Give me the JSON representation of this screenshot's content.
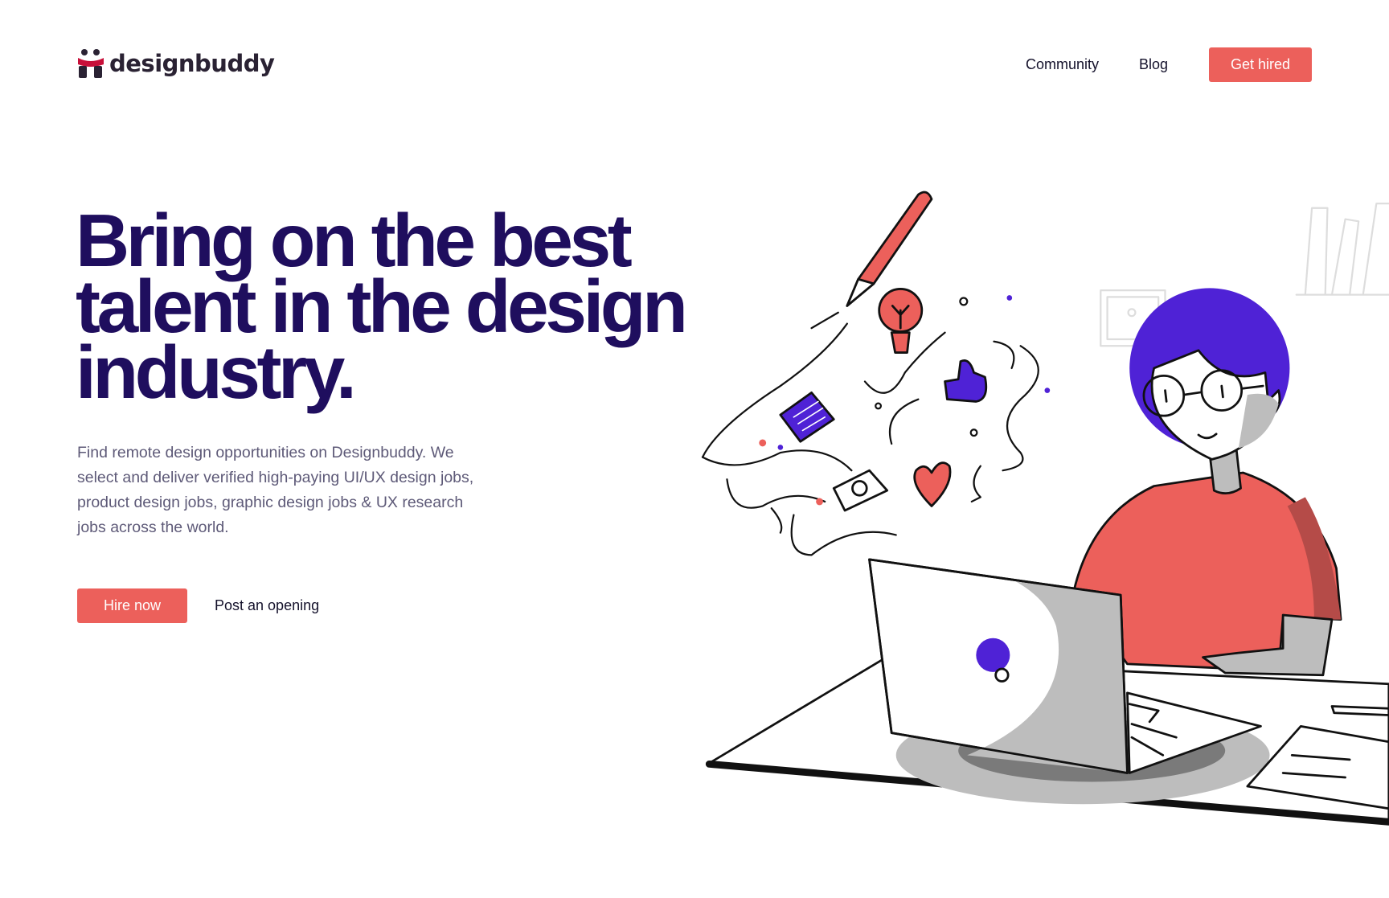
{
  "header": {
    "logo_text": "designbuddy",
    "nav": [
      {
        "label": "Community"
      },
      {
        "label": "Blog"
      }
    ],
    "cta_label": "Get hired"
  },
  "hero": {
    "title_lines": [
      "Bring on the best",
      "talent in the design",
      "industry."
    ],
    "description": "Find remote design opportunities on Designbuddy. We select and deliver verified high-paying UI/UX design jobs, product design jobs, graphic design jobs & UX research jobs across the world.",
    "primary_button": "Hire now",
    "secondary_link": "Post an opening"
  },
  "colors": {
    "accent": "#ec605b",
    "heading": "#1f0e5e",
    "purple": "#4f22d6"
  }
}
